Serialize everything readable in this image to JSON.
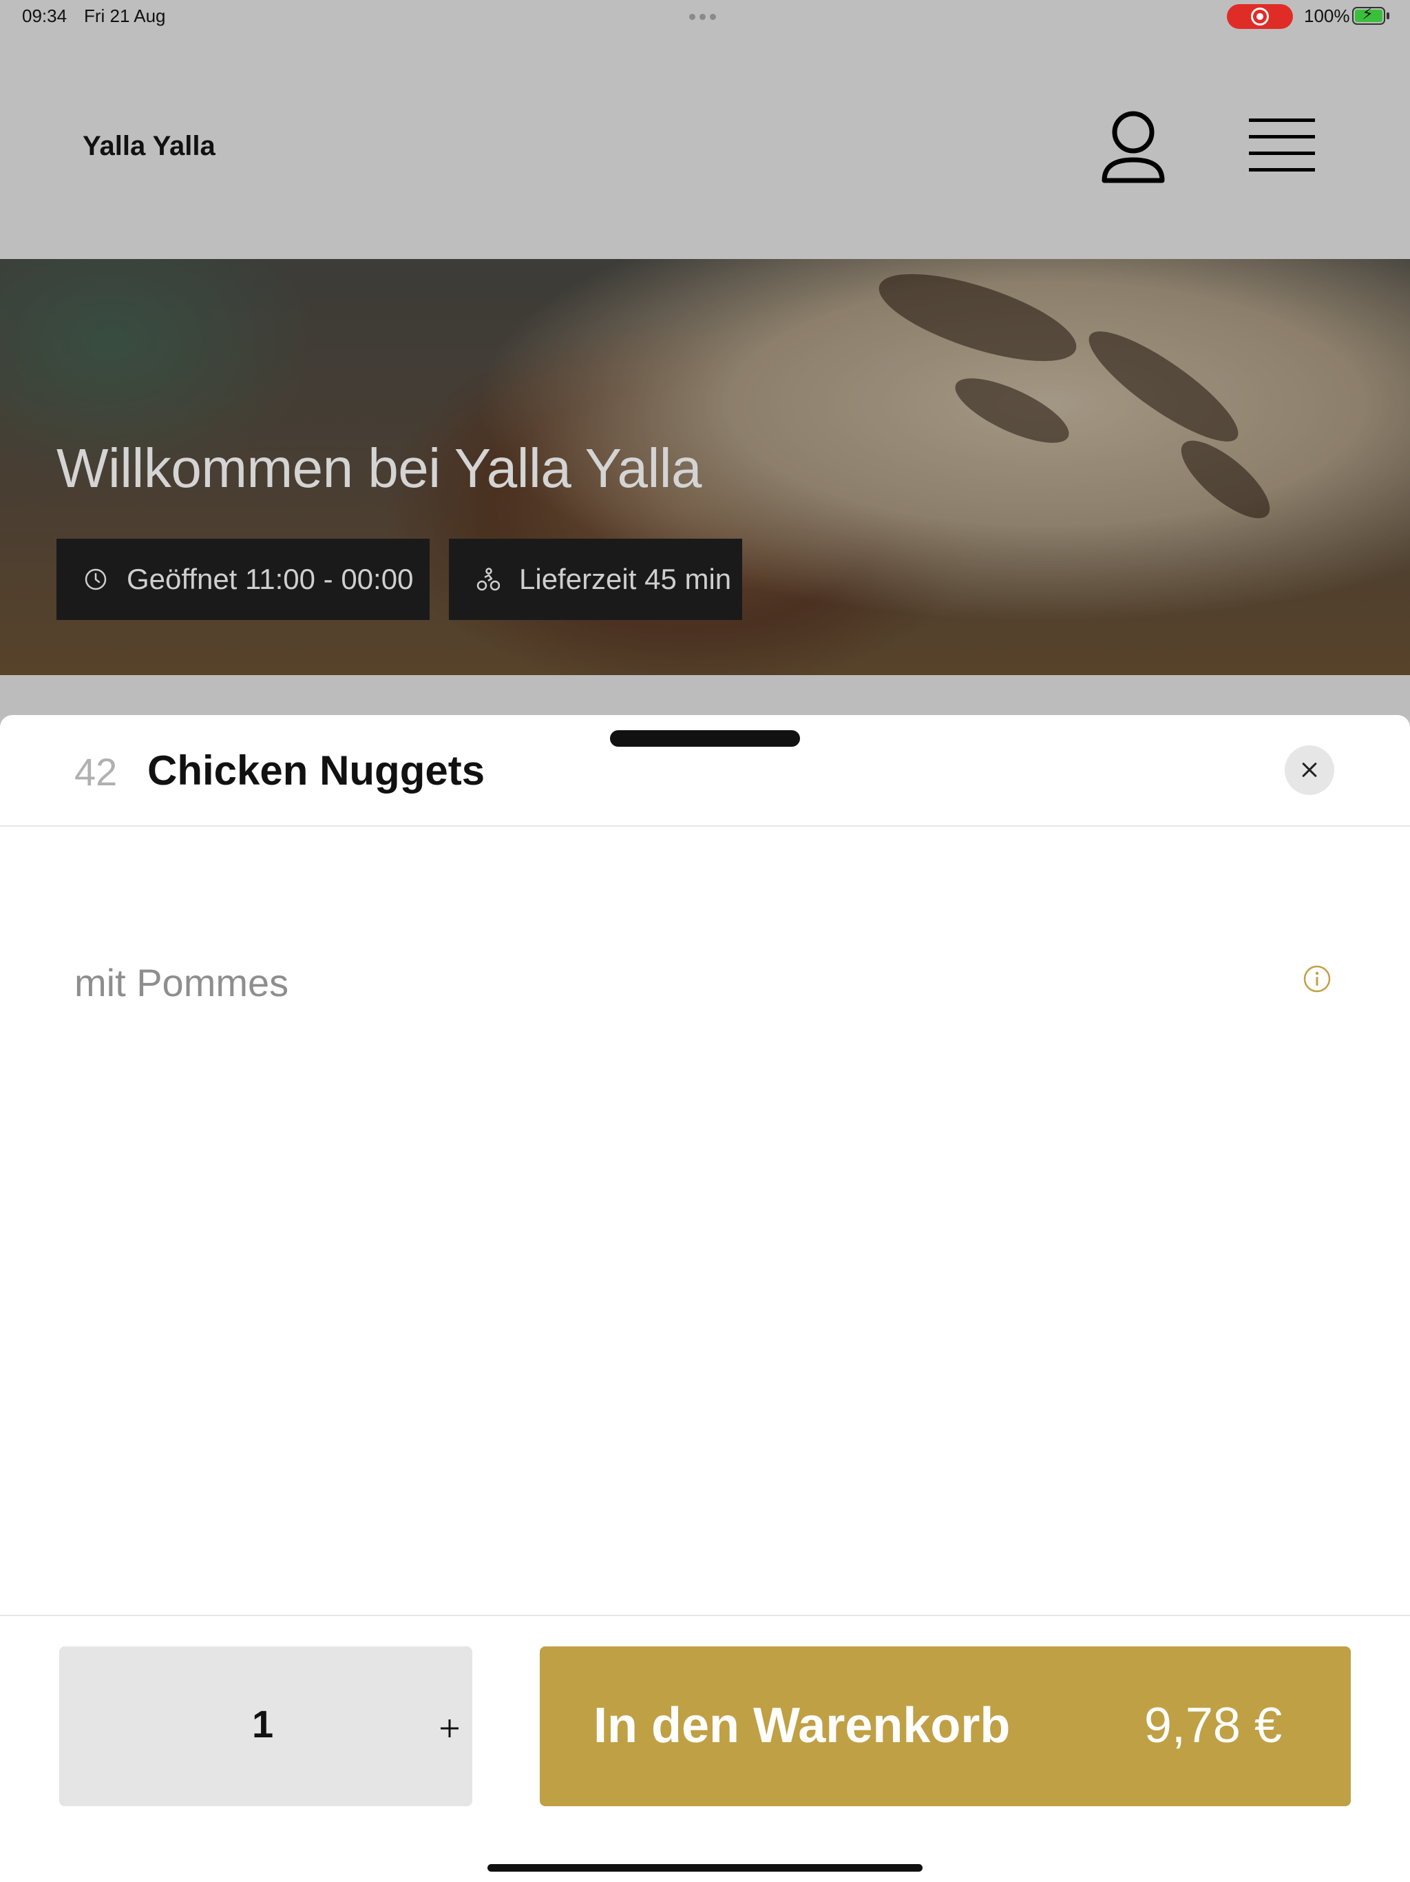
{
  "status_bar": {
    "time": "09:34",
    "date": "Fri 21 Aug",
    "battery_percent": "100%",
    "recording": true,
    "charging": true
  },
  "header": {
    "app_title": "Yalla Yalla",
    "profile_icon": "person-icon",
    "menu_icon": "hamburger-menu-icon"
  },
  "hero": {
    "title": "Willkommen bei Yalla Yalla",
    "hours_label": "Geöffnet 11:00 - 00:00",
    "hours_icon": "clock-icon",
    "delivery_label": "Lieferzeit 45 min",
    "delivery_icon": "bicycle-courier-icon"
  },
  "item_sheet": {
    "number": "42",
    "name": "Chicken Nuggets",
    "description": "mit Pommes",
    "info_icon": "info-icon",
    "close_icon": "close-icon"
  },
  "footer": {
    "quantity": "1",
    "plus_icon": "plus-icon",
    "add_to_cart_label": "In den Warenkorb",
    "price": "9,78 €"
  },
  "colors": {
    "accent": "#c0a044",
    "overlay": "#bebebe",
    "chip_bg": "#1a1a1a"
  }
}
